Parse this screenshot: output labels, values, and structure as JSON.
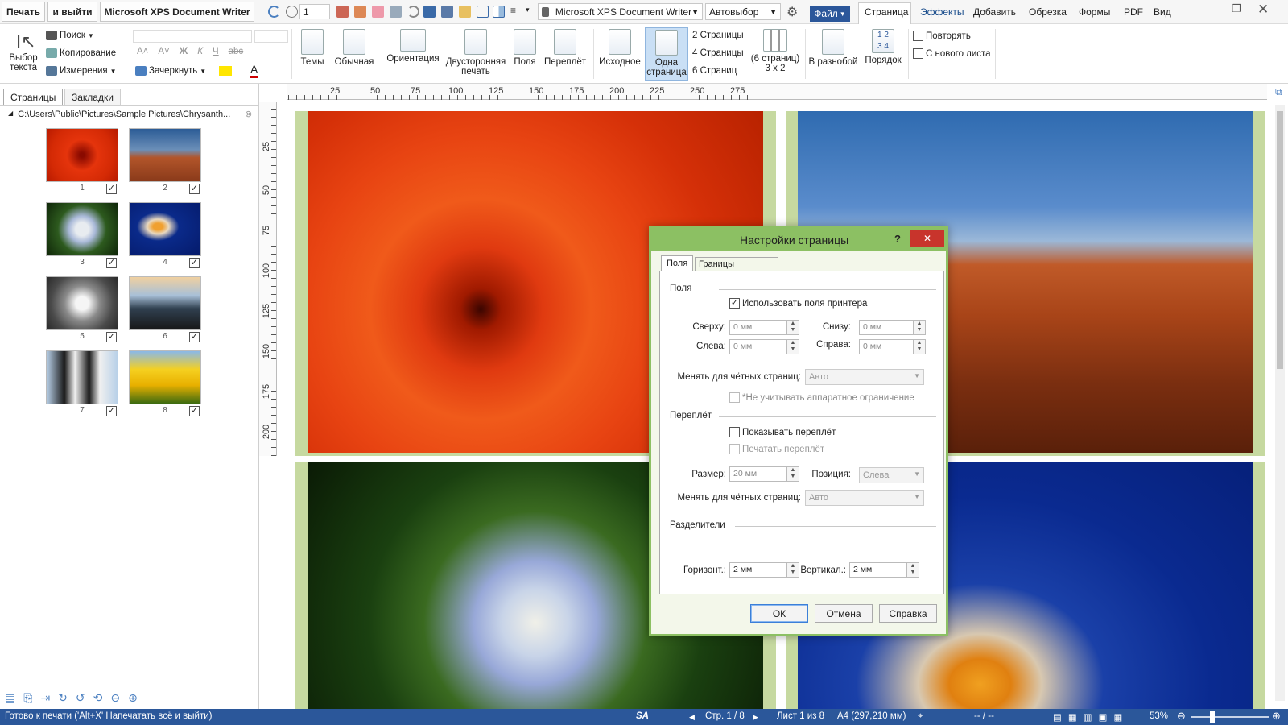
{
  "quickbar": {
    "print_label": "Печать",
    "print_exit_label": "и выйти",
    "printer_label": "Microsoft XPS Document Writer",
    "page_input": "1",
    "printer_combo": "Microsoft XPS Document Writer",
    "tray_combo": "Автовыбор",
    "file_menu": "Файл",
    "menu_tabs": [
      "Страница",
      "Эффекты",
      "Добавить",
      "Обрезка",
      "Формы",
      "PDF",
      "Вид"
    ]
  },
  "ribbon": {
    "select_text": "Выбор текста",
    "search": "Поиск",
    "copy": "Копирование",
    "measure": "Измерения",
    "strike": "Зачеркнуть",
    "themes": "Темы",
    "normal": "Обычная",
    "orientation": "Ориентация",
    "duplex": "Двусторонняя печать",
    "margins": "Поля",
    "binding": "Переплёт",
    "original": "Исходное",
    "one_page": "Одна страница",
    "pages2": "2 Страницы",
    "pages4": "4 Страницы",
    "pages6": "6 Страниц",
    "grid_pages": "(6 страниц) 3 x 2",
    "scattered": "В разнобой",
    "order": "Порядок",
    "repeat": "Повторять",
    "new_sheet": "С нового листа"
  },
  "leftpanel": {
    "tab_pages": "Страницы",
    "tab_bookmarks": "Закладки",
    "folder_path": "C:\\Users\\Public\\Pictures\\Sample Pictures\\Chrysanth...",
    "thumbs": [
      "1",
      "2",
      "3",
      "4",
      "5",
      "6",
      "7",
      "8"
    ]
  },
  "rulers": {
    "h": [
      "25",
      "50",
      "75",
      "100",
      "125",
      "150",
      "175",
      "200",
      "225",
      "250",
      "275"
    ],
    "v": [
      "25",
      "50",
      "75",
      "100",
      "125",
      "150",
      "175",
      "200"
    ]
  },
  "dialog": {
    "title": "Настройки страницы",
    "help": "?",
    "close": "✕",
    "tab_margins": "Поля",
    "tab_borders": "Границы страницы",
    "group_margins": "Поля",
    "use_printer_margins": "Использовать поля принтера",
    "top_label": "Сверху:",
    "top_value": "0 мм",
    "bottom_label": "Снизу:",
    "bottom_value": "0 мм",
    "left_label": "Слева:",
    "left_value": "0 мм",
    "right_label": "Справа:",
    "right_value": "0 мм",
    "even_pages_label": "Менять для чётных страниц:",
    "even_pages_value": "Авто",
    "ignore_hw": "*Не учитывать аппаратное ограничение",
    "group_binding": "Переплёт",
    "show_binding": "Показывать переплёт",
    "print_binding": "Печатать переплёт",
    "size_label": "Размер:",
    "size_value": "20 мм",
    "position_label": "Позиция:",
    "position_value": "Слева",
    "even_pages2_label": "Менять для чётных страниц:",
    "even_pages2_value": "Авто",
    "group_separators": "Разделители",
    "horiz_label": "Горизонт.:",
    "horiz_value": "2 мм",
    "vert_label": "Вертикал.:",
    "vert_value": "2 мм",
    "ok": "ОК",
    "cancel": "Отмена",
    "help_btn": "Справка"
  },
  "status": {
    "ready": "Готово к печати ('Alt+X' Напечатать всё и выйти)",
    "sa": "SA",
    "page": "Стр. 1 / 8",
    "sheet": "Лист 1 из 8",
    "paper": "A4 (297,210 мм)",
    "dash": "-- / --",
    "zoom": "53%"
  },
  "colors": {
    "accent": "#2b579a",
    "dialog": "#8cc063",
    "page_frame": "#c6d9a0"
  }
}
